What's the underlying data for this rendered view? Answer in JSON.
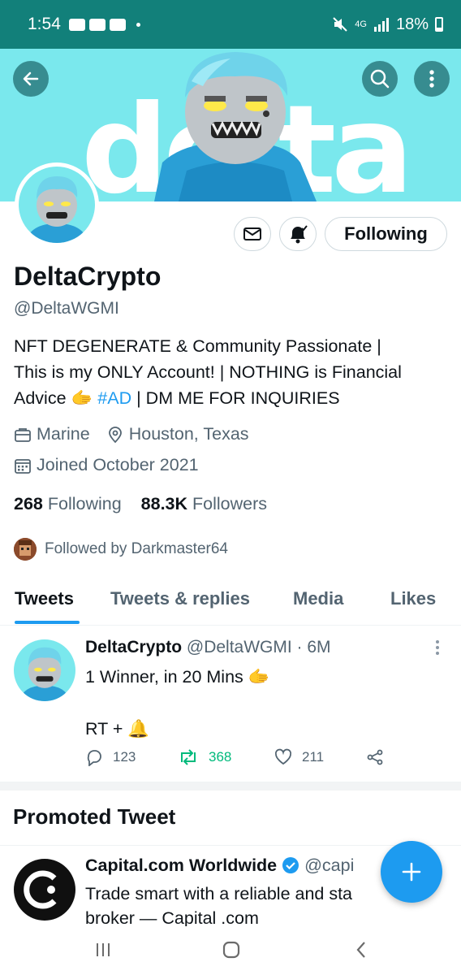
{
  "status_bar": {
    "time": "1:54",
    "network": "4G",
    "battery": "18%"
  },
  "profile": {
    "display_name": "DeltaCrypto",
    "handle": "@DeltaWGMI",
    "bio_line1": "NFT DEGENERATE & Community Passionate |",
    "bio_line2": "This is my ONLY Account! | NOTHING is Financial",
    "bio_line3_prefix": "Advice",
    "bio_hashtag": "#AD",
    "bio_line3_suffix": "| DM ME FOR INQUIRIES",
    "bio_emoji": "🫱",
    "profession": "Marine",
    "location": "Houston, Texas",
    "joined": "Joined October 2021",
    "following_count": "268",
    "following_label": "Following",
    "followers_count": "88.3K",
    "followers_label": "Followers",
    "followed_by": "Followed by Darkmaster64",
    "follow_button_label": "Following"
  },
  "banner": {
    "word": "delta"
  },
  "tabs": [
    {
      "label": "Tweets",
      "active": true
    },
    {
      "label": "Tweets & replies",
      "active": false
    },
    {
      "label": "Media",
      "active": false
    },
    {
      "label": "Likes",
      "active": false
    }
  ],
  "tweet": {
    "author": "DeltaCrypto",
    "handle_time": "@DeltaWGMI · 6M",
    "line1": "1 Winner, in 20 Mins",
    "line1_emoji": "🫱",
    "line2": "RT +",
    "line2_emoji": "🔔",
    "replies": "123",
    "retweets": "368",
    "likes": "211"
  },
  "promoted": {
    "section_title": "Promoted Tweet",
    "author": "Capital.com Worldwide",
    "handle": "@capi",
    "line1": "Trade smart with a reliable and sta",
    "line2": "broker — Capital .com"
  },
  "colors": {
    "status_bar": "#12807a",
    "banner_bg": "#7ae8ed",
    "accent": "#1d9bf0",
    "retweet_green": "#00ba7c",
    "muted_text": "#536471"
  }
}
